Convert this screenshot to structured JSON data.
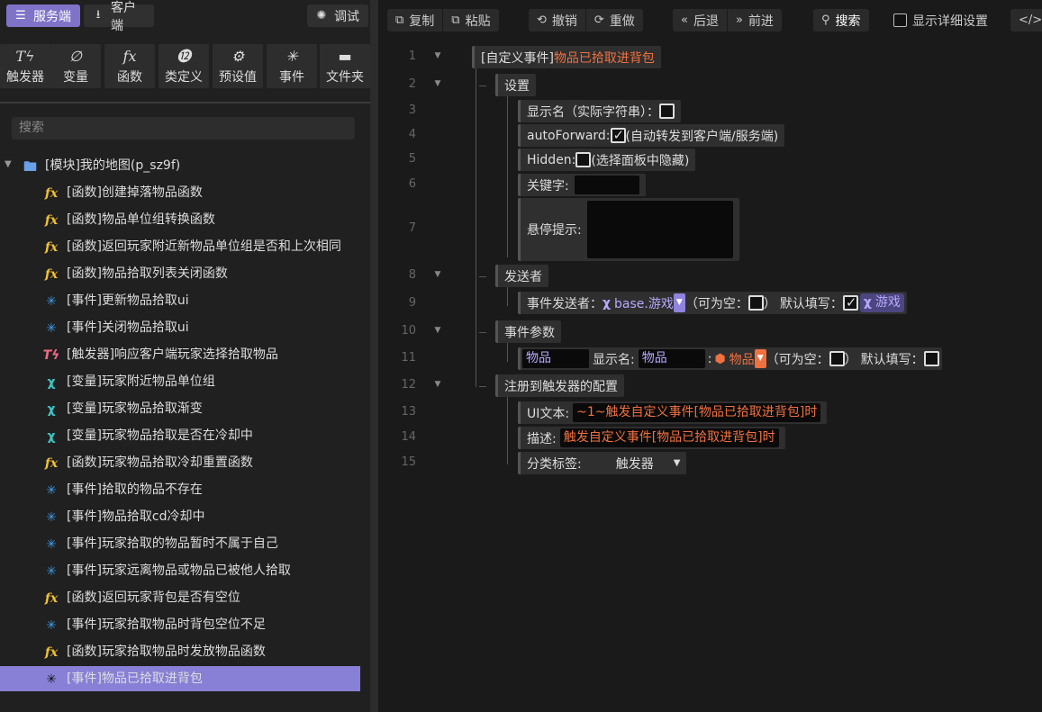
{
  "top_tabs": {
    "server": "服务端",
    "client": "客户端",
    "debug": "调试"
  },
  "tools": [
    {
      "icon": "Tϟ",
      "label": "触发器"
    },
    {
      "icon": "∅",
      "label": "变量"
    },
    {
      "icon": "fx",
      "label": "函数"
    },
    {
      "icon": "⓬",
      "label": "类定义"
    },
    {
      "icon": "⚙",
      "label": "预设值"
    },
    {
      "icon": "✳",
      "label": "事件"
    },
    {
      "icon": "▬",
      "label": "文件夹"
    }
  ],
  "search": {
    "placeholder": "搜索"
  },
  "tree": {
    "root": "[模块]我的地图(p_sz9f)",
    "items": [
      {
        "type": "fx",
        "label": "[函数]创建掉落物品函数"
      },
      {
        "type": "fx",
        "label": "[函数]物品单位组转换函数"
      },
      {
        "type": "fx",
        "label": "[函数]返回玩家附近新物品单位组是否和上次相同"
      },
      {
        "type": "fx",
        "label": "[函数]物品拾取列表关闭函数"
      },
      {
        "type": "ev",
        "label": "[事件]更新物品拾取ui"
      },
      {
        "type": "ev",
        "label": "[事件]关闭物品拾取ui"
      },
      {
        "type": "tr",
        "label": "[触发器]响应客户端玩家选择拾取物品"
      },
      {
        "type": "vr",
        "label": "[变量]玩家附近物品单位组"
      },
      {
        "type": "vr",
        "label": "[变量]玩家物品拾取渐变"
      },
      {
        "type": "vr",
        "label": "[变量]玩家物品拾取是否在冷却中"
      },
      {
        "type": "fx",
        "label": "[函数]玩家物品拾取冷却重置函数"
      },
      {
        "type": "ev",
        "label": "[事件]拾取的物品不存在"
      },
      {
        "type": "ev",
        "label": "[事件]物品拾取cd冷却中"
      },
      {
        "type": "ev",
        "label": "[事件]玩家拾取的物品暂时不属于自己"
      },
      {
        "type": "ev",
        "label": "[事件]玩家远离物品或物品已被他人拾取"
      },
      {
        "type": "fx",
        "label": "[函数]返回玩家背包是否有空位"
      },
      {
        "type": "ev",
        "label": "[事件]玩家拾取物品时背包空位不足"
      },
      {
        "type": "fx",
        "label": "[函数]玩家拾取物品时发放物品函数"
      },
      {
        "type": "ev",
        "label": "[事件]物品已拾取进背包"
      }
    ]
  },
  "toolbar": {
    "copy": "复制",
    "paste": "粘贴",
    "undo": "撤销",
    "redo": "重做",
    "back": "后退",
    "forward": "前进",
    "search": "搜索",
    "detail": "显示详细设置"
  },
  "editor": {
    "lines": [
      "1",
      "2",
      "3",
      "4",
      "5",
      "6",
      "7",
      "8",
      "9",
      "10",
      "11",
      "12",
      "13",
      "14",
      "15"
    ],
    "event_header": "[自定义事件]",
    "event_name": "物品已拾取进背包",
    "settings": "设置",
    "display_name": "显示名（实际字符串）：",
    "auto_forward": "autoForward:",
    "auto_forward_desc": "(自动转发到客户端/服务端)",
    "hidden": "Hidden:",
    "hidden_desc": "(选择面板中隐藏)",
    "keyword": "关键字:",
    "tooltip": "悬停提示:",
    "sender": "发送者",
    "event_sender": "事件发送者：",
    "sender_type": "base.游戏",
    "nullable": "（可为空：",
    "close_paren": "）",
    "default_fill": "默认填写：",
    "default_value": "游戏",
    "params": "事件参数",
    "param_name": "物品",
    "param_display": "显示名:",
    "param_display_value": "物品",
    "param_type": "物品",
    "colon": ":",
    "register": "注册到触发器的配置",
    "ui_text": "UI文本:",
    "ui_text_value": "~1~触发自定义事件[物品已拾取进背包]时",
    "desc": "描述:",
    "desc_value": "触发自定义事件[物品已拾取进背包]时",
    "category": "分类标签:",
    "category_value": "触发器"
  }
}
